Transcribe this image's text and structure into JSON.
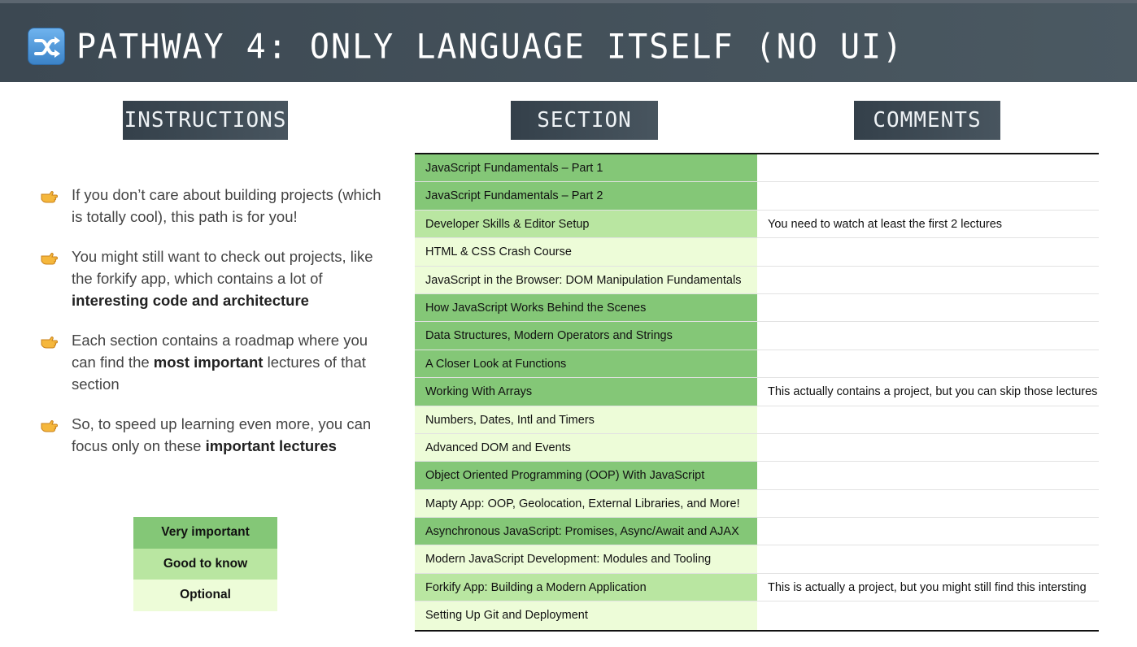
{
  "header": {
    "title": "PATHWAY 4: ONLY LANGUAGE ITSELF (NO UI)",
    "icon": "shuffle-icon"
  },
  "columns": {
    "instructions": "INSTRUCTIONS",
    "section": "SECTION",
    "comments": "COMMENTS"
  },
  "bullets": [
    {
      "parts": [
        {
          "t": "If you don’t care about building projects (which is totally cool), this path is for you!",
          "b": false
        }
      ]
    },
    {
      "parts": [
        {
          "t": "You might still want to check out projects, like the forkify app, which contains a lot of ",
          "b": false
        },
        {
          "t": "interesting code and architecture",
          "b": true
        }
      ]
    },
    {
      "parts": [
        {
          "t": "Each section contains a roadmap where you can find the ",
          "b": false
        },
        {
          "t": "most important",
          "b": true
        },
        {
          "t": " lectures of that section",
          "b": false
        }
      ]
    },
    {
      "parts": [
        {
          "t": "So, to speed up learning even more, you can focus only on these ",
          "b": false
        },
        {
          "t": "important lectures",
          "b": true
        }
      ]
    }
  ],
  "legend": [
    {
      "label": "Very important",
      "level": "very",
      "color": "#84c777"
    },
    {
      "label": "Good to know",
      "level": "good",
      "color": "#b9e6a1"
    },
    {
      "label": "Optional",
      "level": "opt",
      "color": "#edfcd8"
    }
  ],
  "rows": [
    {
      "section": "JavaScript Fundamentals – Part 1",
      "level": "very",
      "comment": ""
    },
    {
      "section": "JavaScript Fundamentals – Part 2",
      "level": "very",
      "comment": ""
    },
    {
      "section": "Developer Skills & Editor Setup",
      "level": "good",
      "comment": "You need to watch at least the first 2 lectures"
    },
    {
      "section": "HTML & CSS Crash Course",
      "level": "opt",
      "comment": ""
    },
    {
      "section": "JavaScript in the Browser: DOM Manipulation Fundamentals",
      "level": "opt",
      "comment": ""
    },
    {
      "section": "How JavaScript Works Behind the Scenes",
      "level": "very",
      "comment": ""
    },
    {
      "section": "Data Structures, Modern Operators and Strings",
      "level": "very",
      "comment": ""
    },
    {
      "section": "A Closer Look at Functions",
      "level": "very",
      "comment": ""
    },
    {
      "section": "Working With Arrays",
      "level": "very",
      "comment": "This actually contains a project, but you can skip those lectures"
    },
    {
      "section": "Numbers, Dates, Intl and Timers",
      "level": "opt",
      "comment": ""
    },
    {
      "section": "Advanced DOM and Events",
      "level": "opt",
      "comment": ""
    },
    {
      "section": "Object Oriented Programming (OOP) With JavaScript",
      "level": "very",
      "comment": ""
    },
    {
      "section": "Mapty App: OOP, Geolocation, External Libraries, and More!",
      "level": "opt",
      "comment": ""
    },
    {
      "section": "Asynchronous JavaScript: Promises, Async/Await and AJAX",
      "level": "very",
      "comment": ""
    },
    {
      "section": "Modern JavaScript Development: Modules and Tooling",
      "level": "opt",
      "comment": ""
    },
    {
      "section": "Forkify App: Building a Modern Application",
      "level": "good",
      "comment": "This is actually a project, but you might still find this intersting"
    },
    {
      "section": "Setting Up Git and Deployment",
      "level": "opt",
      "comment": ""
    }
  ]
}
